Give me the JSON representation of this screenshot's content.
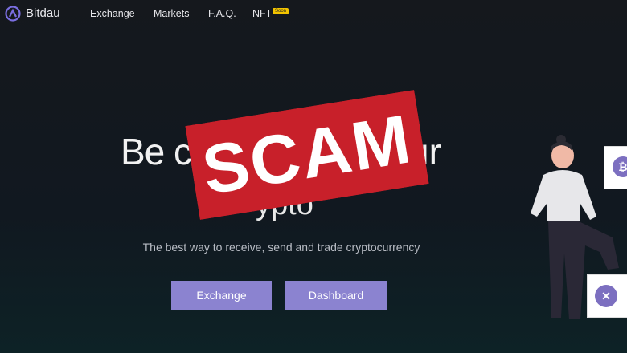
{
  "nav": {
    "brand": "Bitdau",
    "items": [
      "Exchange",
      "Markets",
      "F.A.Q.",
      "NFT"
    ],
    "badge": "Soon"
  },
  "hero": {
    "headline_visible_left": "Be c",
    "headline_visible_right": "ur",
    "headline_line2_visible": "ypto",
    "subtitle": "The best way to receive, send and trade cryptocurrency",
    "buttons": {
      "exchange": "Exchange",
      "dashboard": "Dashboard"
    }
  },
  "overlay": {
    "stamp_text": "SCAM",
    "stamp_color": "#c8202a"
  },
  "colors": {
    "accent": "#8b83d0",
    "badge": "#f3c400"
  },
  "icons": {
    "logo": "bitdau-logo-icon",
    "bitcoin": "bitcoin-icon",
    "xrp": "xrp-icon"
  }
}
